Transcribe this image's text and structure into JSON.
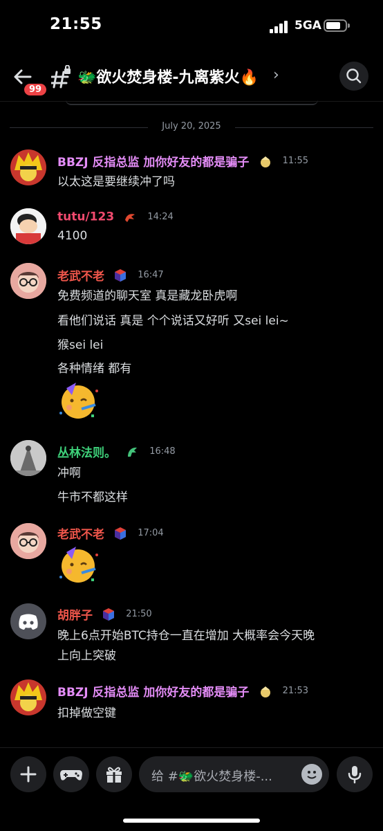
{
  "status_bar": {
    "time": "21:55",
    "network": "5GA"
  },
  "header": {
    "unread_badge": "99",
    "channel_name": "🐲欲火焚身楼-九离紫火🔥",
    "chevron": "›"
  },
  "date_divider": "July 20, 2025",
  "messages": [
    {
      "author": "BBZJ 反指总监  加你好友的都是骗子",
      "author_color": "#e38cf6",
      "role_icon": "yellow-star-icon",
      "time": "11:55",
      "lines": [
        "以太这是要继续冲了吗"
      ]
    },
    {
      "author": "tutu/123",
      "author_color": "#f04a6e",
      "role_icon": "red-dragon-icon",
      "time": "14:24",
      "lines": [
        "4100"
      ]
    },
    {
      "author": "老武不老",
      "author_color": "#f0564b",
      "role_icon": "red-blue-cube-icon",
      "time": "16:47",
      "lines": [
        "免费频道的聊天室  真是藏龙卧虎啊",
        "看他们说话 真是 个个说话又好听 又sei lei~",
        "猴sei lei",
        "各种情绪 都有"
      ],
      "emoji": "🥳"
    },
    {
      "author": "丛林法则。",
      "author_color": "#3ed17a",
      "role_icon": "green-dragon-icon",
      "time": "16:48",
      "lines": [
        "冲啊",
        "牛市不都这样"
      ]
    },
    {
      "author": "老武不老",
      "author_color": "#f0564b",
      "role_icon": "red-blue-cube-icon",
      "time": "17:04",
      "lines": [],
      "emoji": "🥳"
    },
    {
      "author": "胡胖子",
      "author_color": "#f0564b",
      "role_icon": "red-blue-cube-icon",
      "time": "21:50",
      "lines": [
        "晚上6点开始BTC持仓一直在增加 大概率会今天晚",
        "上向上突破"
      ]
    },
    {
      "author": "BBZJ 反指总监  加你好友的都是骗子",
      "author_color": "#e38cf6",
      "role_icon": "yellow-star-icon",
      "time": "21:53",
      "lines": [
        "扣掉做空键"
      ]
    }
  ],
  "composer": {
    "placeholder": "给 #🐲欲火焚身楼-..."
  }
}
